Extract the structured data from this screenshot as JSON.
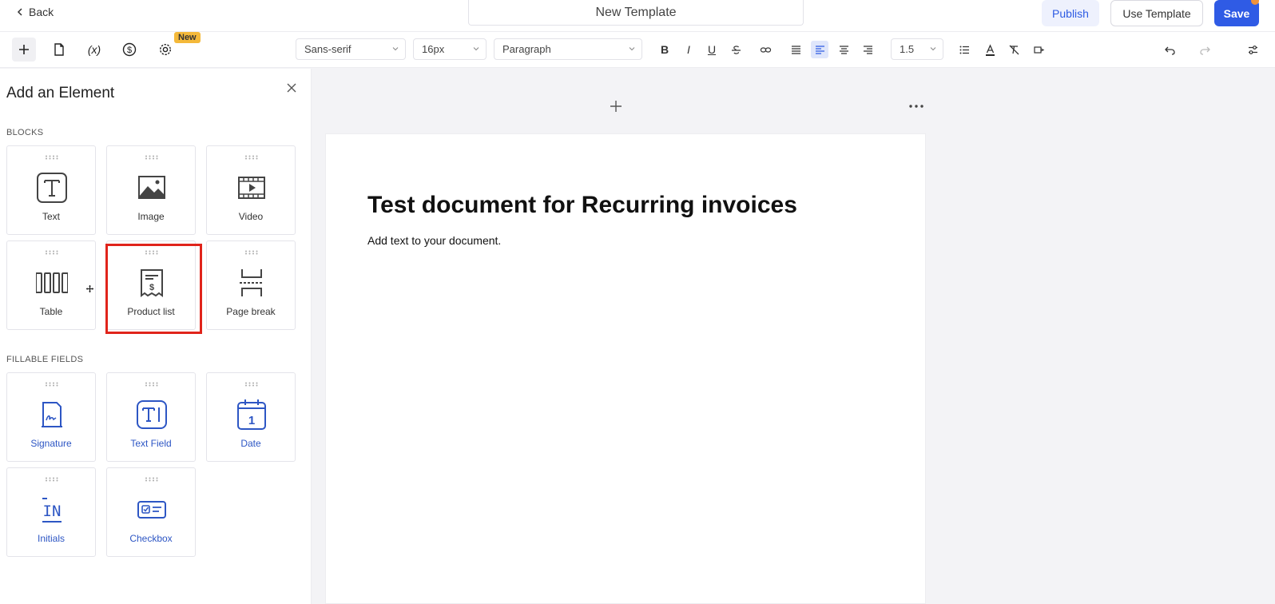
{
  "header": {
    "back_label": "Back",
    "template_name": "New Template",
    "publish_label": "Publish",
    "use_template_label": "Use Template",
    "save_label": "Save"
  },
  "toolbar": {
    "new_badge": "New",
    "variables_label": "(x)",
    "font_family": "Sans-serif",
    "font_size": "16px",
    "block_style": "Paragraph",
    "line_height": "1.5",
    "bold": "B",
    "italic": "I",
    "underline": "U"
  },
  "panel": {
    "title": "Add an Element",
    "blocks_heading": "BLOCKS",
    "fields_heading": "FILLABLE FIELDS",
    "blocks": [
      {
        "label": "Text",
        "icon": "text-icon"
      },
      {
        "label": "Image",
        "icon": "image-icon"
      },
      {
        "label": "Video",
        "icon": "video-icon"
      },
      {
        "label": "Table",
        "icon": "table-icon"
      },
      {
        "label": "Product list",
        "icon": "product-list-icon"
      },
      {
        "label": "Page break",
        "icon": "page-break-icon"
      }
    ],
    "fields": [
      {
        "label": "Signature",
        "icon": "signature-icon"
      },
      {
        "label": "Text Field",
        "icon": "text-field-icon"
      },
      {
        "label": "Date",
        "icon": "date-icon",
        "icon_text": "1"
      },
      {
        "label": "Initials",
        "icon": "initials-icon",
        "icon_text": "IN"
      },
      {
        "label": "Checkbox",
        "icon": "checkbox-icon"
      }
    ]
  },
  "document": {
    "title": "Test document for Recurring invoices",
    "body": "Add text to your document."
  },
  "colors": {
    "accent": "#2f5be5",
    "highlight": "#e0241b",
    "badge": "#f4b93a",
    "field_blue": "#2d56c4"
  }
}
